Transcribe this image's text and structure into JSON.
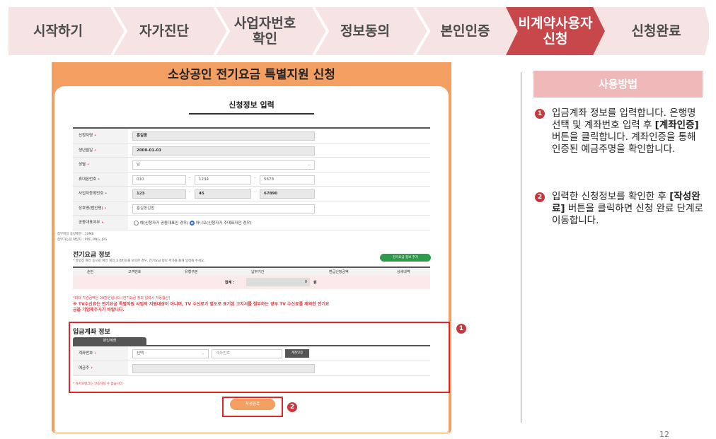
{
  "steps": [
    {
      "label": "시작하기"
    },
    {
      "label": "자가진단"
    },
    {
      "label": "사업자번호",
      "label2": "확인"
    },
    {
      "label": "정보동의"
    },
    {
      "label": "본인인증"
    },
    {
      "label": "비계약사용자",
      "label2": "신청",
      "active": true
    },
    {
      "label": "신청완료"
    }
  ],
  "screen": {
    "title": "소상공인 전기요금 특별지원 신청",
    "card_title": "신청정보 입력",
    "form": {
      "applicant_label": "신청자명",
      "applicant_value": "홍길동",
      "birth_label": "생년월일",
      "birth_value": "2000-01-01",
      "gender_label": "성별",
      "gender_value": "남",
      "phone_label": "휴대폰번호",
      "phone_1": "010",
      "phone_2": "1234",
      "phone_3": "5678",
      "bizno_label": "사업자등록번호",
      "bizno_1": "123",
      "bizno_2": "45",
      "bizno_3": "67890",
      "company_label": "상호명(법인명)",
      "company_value": "홍길동김밥",
      "corep_label": "공동대표여부",
      "corep_yes": "예(신청자가 공동대표인 경우)",
      "corep_no": "아니오(신청자가 주대표자인 경우)"
    },
    "attach_note_1": "· 첨부파일 용량제한 : 10MB",
    "attach_note_2": "· 첨부가능한 확장자 : PDF, PNG, JPG",
    "bill": {
      "title": "전기요금 정보",
      "subnote": "* 영업장 여러 동으로 여러 개의 고객번호를 보유한 경우, 전기요금 정보 추가를 통해 입력해 주세요.",
      "add_button": "전기요금 정보 추가",
      "columns": [
        "순번",
        "고객번호",
        "유형구분",
        "납부기간",
        "환급신청금액",
        "상세내역"
      ],
      "sum_label": "합계 :",
      "sum_value": "0",
      "sum_unit": "원"
    },
    "note_max": "*최대 지원금액은 20만원입니다.(전기요금 정보 입력시 자동합산)",
    "note_tv_1": "※ TV수신료는 전기요금 특별지원 사업의 지원대상이 아니며, TV 수신료가 별도로 표기된 고지서를 첨부하는 경우 TV 수신료를 제외한 전기요",
    "note_tv_2": "금을 기입해주시기 바랍니다.",
    "account": {
      "title": "입금계좌 정보",
      "tab": "본인계좌",
      "acct_label": "계좌번호",
      "bank_placeholder": "선택",
      "acct_placeholder": "계좌번호",
      "verify_button": "계좌인증",
      "holder_label": "예금주",
      "note": "* 카카오뱅크는 인증하실 수 없습니다."
    },
    "submit": "작성완료"
  },
  "markers": {
    "one": "1",
    "two": "2"
  },
  "help": {
    "title": "사용방법",
    "item1": "입금계좌 정보를 입력합니다. 은행명 선택 및 계좌번호 입력 후 ",
    "item1_bold": "[계좌인증]",
    "item1_rest": " 버튼을 클릭합니다. 계좌인증을 통해 인증된 예금주명을 확인합니다.",
    "item2": "입력한 신청정보를 확인한 후 ",
    "item2_bold": "[작성완료]",
    "item2_rest": " 버튼을 클릭하면 신청 완료 단계로 이동합니다."
  },
  "page_number": "12",
  "colors": {
    "accent": "#c8474b",
    "orange": "#f39f62",
    "highlight": "#e0262c"
  }
}
